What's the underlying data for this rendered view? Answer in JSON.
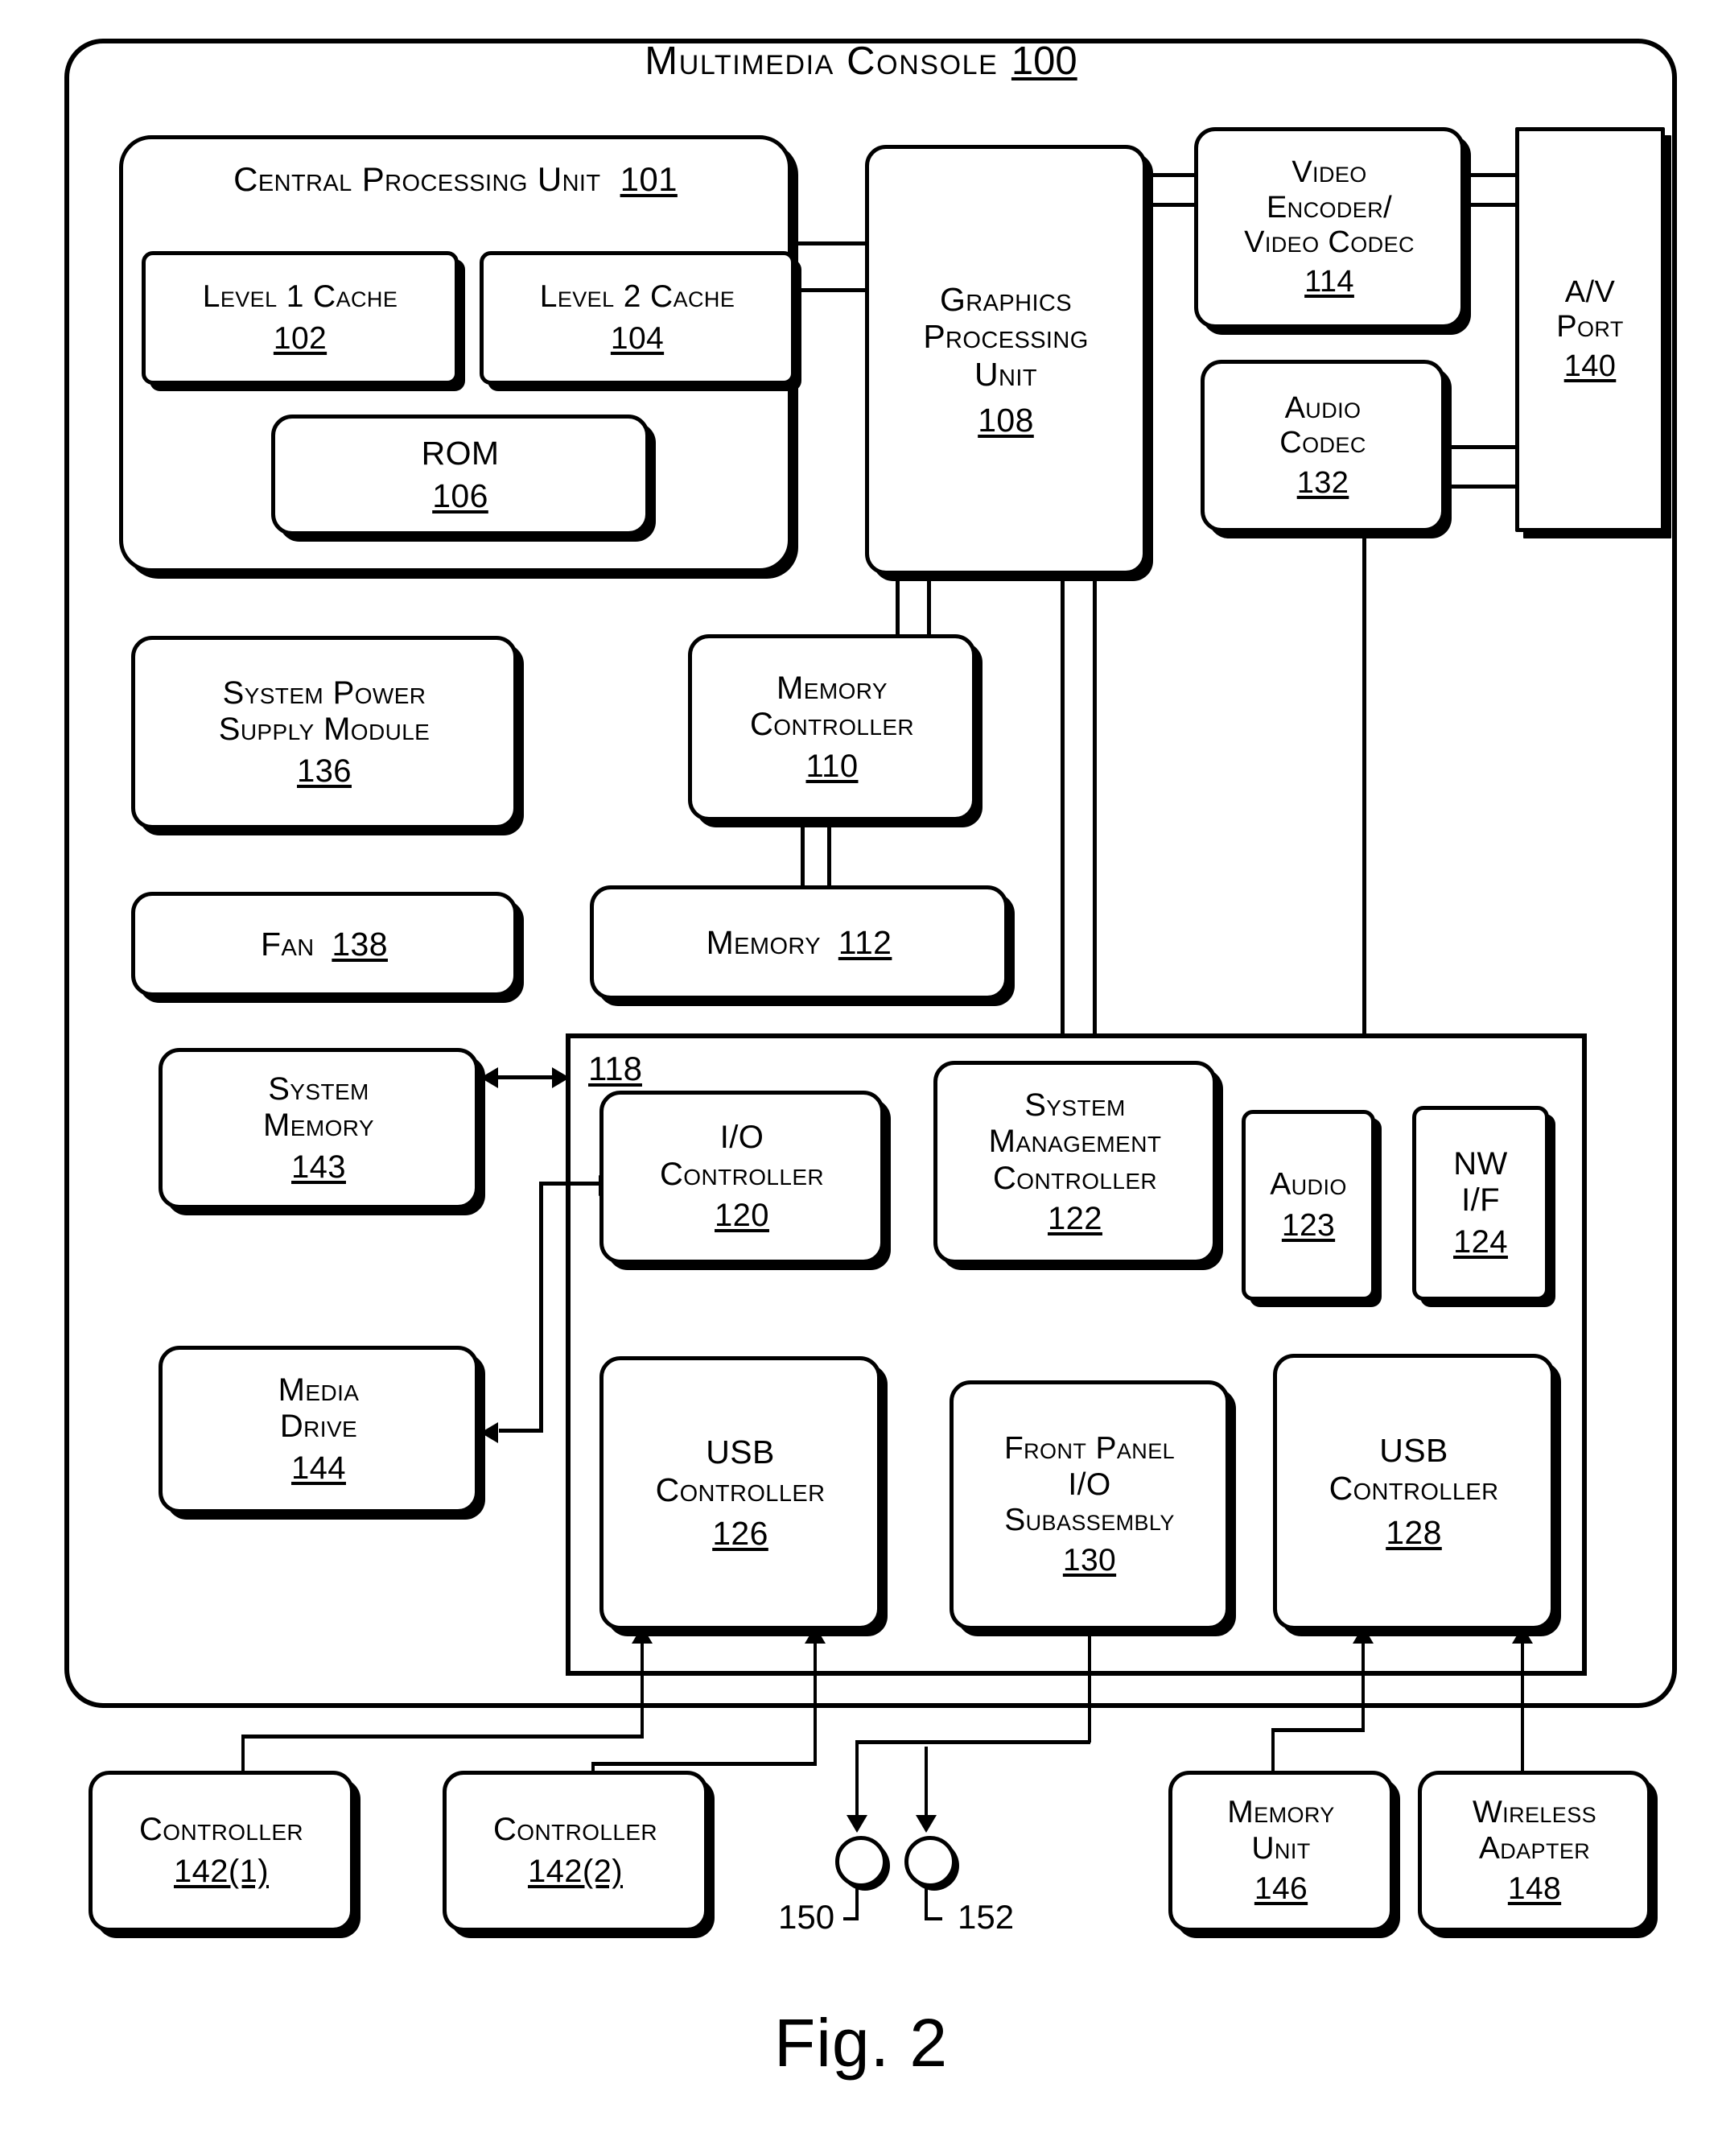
{
  "figure": {
    "caption": "Fig. 2",
    "title": "Multimedia Console",
    "title_ref": "100"
  },
  "blocks": {
    "cpu": {
      "lines": [
        "Central Processing Unit"
      ],
      "ref": "101"
    },
    "l1_cache": {
      "lines": [
        "Level 1 Cache"
      ],
      "ref": "102"
    },
    "l2_cache": {
      "lines": [
        "Level 2 Cache"
      ],
      "ref": "104"
    },
    "rom": {
      "lines": [
        "ROM"
      ],
      "ref": "106"
    },
    "gpu": {
      "lines": [
        "Graphics",
        "Processing",
        "Unit"
      ],
      "ref": "108"
    },
    "video_encoder": {
      "lines": [
        "Video",
        "Encoder/",
        "Video Codec"
      ],
      "ref": "114"
    },
    "audio_codec": {
      "lines": [
        "Audio",
        "Codec"
      ],
      "ref": "132"
    },
    "av_port": {
      "lines": [
        "A/V",
        "Port"
      ],
      "ref": "140"
    },
    "power_supply": {
      "lines": [
        "System Power",
        "Supply Module"
      ],
      "ref": "136"
    },
    "fan": {
      "lines": [
        "Fan"
      ],
      "ref": "138",
      "inline": true
    },
    "memory_controller": {
      "lines": [
        "Memory",
        "Controller"
      ],
      "ref": "110"
    },
    "memory": {
      "lines": [
        "Memory"
      ],
      "ref": "112",
      "inline": true
    },
    "system_memory": {
      "lines": [
        "System",
        "Memory"
      ],
      "ref": "143"
    },
    "media_drive": {
      "lines": [
        "Media",
        "Drive"
      ],
      "ref": "144"
    },
    "io_controller": {
      "lines": [
        "I/O",
        "Controller"
      ],
      "ref": "120"
    },
    "system_mgmt_controller": {
      "lines": [
        "System",
        "Management",
        "Controller"
      ],
      "ref": "122"
    },
    "audio": {
      "lines": [
        "Audio"
      ],
      "ref": "123"
    },
    "nw_if": {
      "lines": [
        "NW",
        "I/F"
      ],
      "ref": "124"
    },
    "usb_controller_126": {
      "lines": [
        "USB",
        "Controller"
      ],
      "ref": "126"
    },
    "front_panel": {
      "lines": [
        "Front Panel",
        "I/O",
        "Subassembly"
      ],
      "ref": "130"
    },
    "usb_controller_128": {
      "lines": [
        "USB",
        "Controller"
      ],
      "ref": "128"
    },
    "controller_1": {
      "lines": [
        "Controller"
      ],
      "ref": "142(1)"
    },
    "controller_2": {
      "lines": [
        "Controller"
      ],
      "ref": "142(2)"
    },
    "memory_unit": {
      "lines": [
        "Memory",
        "Unit"
      ],
      "ref": "146"
    },
    "wireless_adapter": {
      "lines": [
        "Wireless",
        "Adapter"
      ],
      "ref": "148"
    }
  },
  "refs": {
    "subsystem_118": "118",
    "peripheral_150": "150",
    "peripheral_152": "152"
  },
  "colors": {
    "ink": "#000000",
    "paper": "#ffffff"
  }
}
